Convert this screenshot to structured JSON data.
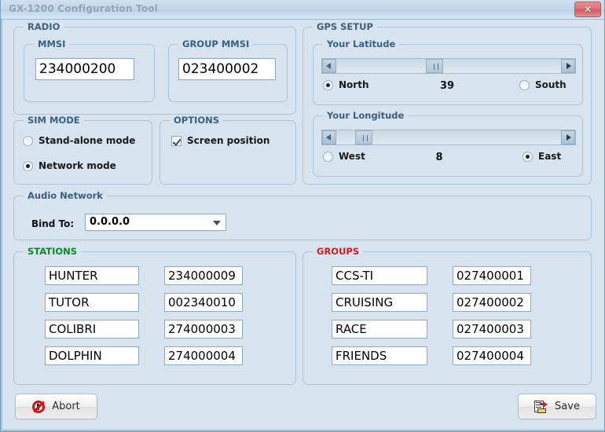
{
  "window": {
    "title": "GX-1200 Configuration Tool",
    "close_label": "✕"
  },
  "radio_group": {
    "legend": "RADIO",
    "mmsi": {
      "legend": "MMSI",
      "value": "234000200"
    },
    "group_mmsi": {
      "legend": "GROUP MMSI",
      "value": "023400002"
    }
  },
  "sim_mode": {
    "legend": "SIM MODE",
    "options": [
      {
        "label": "Stand-alone mode",
        "selected": false
      },
      {
        "label": "Network mode",
        "selected": true
      }
    ]
  },
  "options": {
    "legend": "OPTIONS",
    "items": [
      {
        "label": "Screen position",
        "checked": true
      }
    ]
  },
  "gps_setup": {
    "legend": "GPS SETUP",
    "latitude": {
      "legend": "Your Latitude",
      "value": "39",
      "thumb_percent": 43,
      "hemispheres": [
        {
          "label": "North",
          "selected": true
        },
        {
          "label": "South",
          "selected": false
        }
      ]
    },
    "longitude": {
      "legend": "Your Longitude",
      "value": "8",
      "thumb_percent": 9,
      "hemispheres": [
        {
          "label": "West",
          "selected": false
        },
        {
          "label": "East",
          "selected": true
        }
      ]
    }
  },
  "audio_network": {
    "legend": "Audio Network",
    "bind_to_label": "Bind To:",
    "bind_to_value": "0.0.0.0"
  },
  "stations": {
    "legend": "STATIONS",
    "legend_color": "#0a8a2a",
    "rows": [
      {
        "name": "HUNTER",
        "mmsi": "234000009"
      },
      {
        "name": "TUTOR",
        "mmsi": "002340010"
      },
      {
        "name": "COLIBRI",
        "mmsi": "274000003"
      },
      {
        "name": "DOLPHIN",
        "mmsi": "274000004"
      }
    ]
  },
  "groups": {
    "legend": "GROUPS",
    "legend_color": "#d41b1b",
    "rows": [
      {
        "name": "CCS-TI",
        "mmsi": "027400001"
      },
      {
        "name": "CRUISING",
        "mmsi": "027400002"
      },
      {
        "name": "RACE",
        "mmsi": "027400003"
      },
      {
        "name": "FRIENDS",
        "mmsi": "027400004"
      }
    ]
  },
  "footer": {
    "abort_label": "Abort",
    "save_label": "Save"
  }
}
